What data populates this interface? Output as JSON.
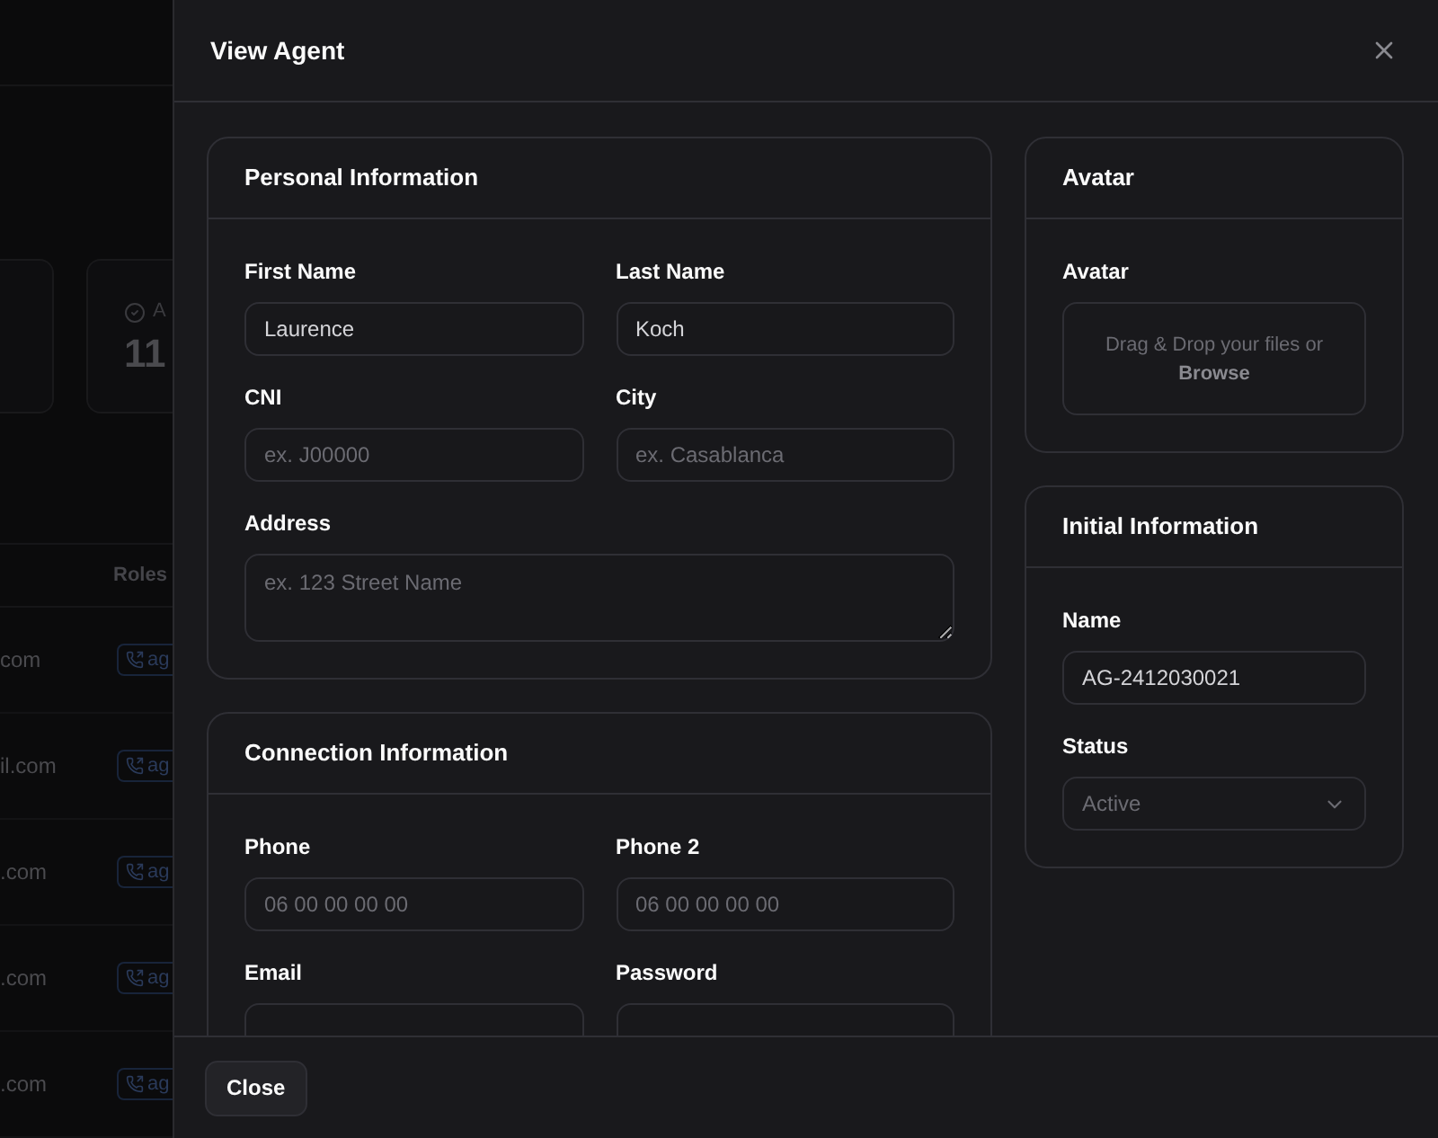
{
  "background": {
    "stat_card": {
      "label": "A",
      "value": "11"
    },
    "table": {
      "columns": [
        "Roles"
      ],
      "rows": [
        {
          "email": "com",
          "role": "ag"
        },
        {
          "email": "il.com",
          "role": "ag"
        },
        {
          "email": ".com",
          "role": "ag"
        },
        {
          "email": ".com",
          "role": "ag"
        },
        {
          "email": ".com",
          "role": "ag"
        }
      ]
    }
  },
  "drawer": {
    "title": "View Agent",
    "left_sections": [
      {
        "title": "Personal Information",
        "fields": [
          {
            "kind": "input",
            "label": "First Name",
            "value": "Laurence"
          },
          {
            "kind": "input",
            "label": "Last Name",
            "value": "Koch"
          },
          {
            "kind": "input",
            "label": "CNI",
            "placeholder": "ex. J00000"
          },
          {
            "kind": "input",
            "label": "City",
            "placeholder": "ex. Casablanca"
          },
          {
            "kind": "textarea",
            "label": "Address",
            "placeholder": "ex. 123 Street Name"
          }
        ]
      },
      {
        "title": "Connection Information",
        "fields": [
          {
            "kind": "input",
            "label": "Phone",
            "placeholder": "06 00 00 00 00"
          },
          {
            "kind": "input",
            "label": "Phone 2",
            "placeholder": "06 00 00 00 00"
          },
          {
            "kind": "input",
            "label": "Email"
          },
          {
            "kind": "input",
            "label": "Password"
          }
        ]
      }
    ],
    "right_sections": [
      {
        "title": "Avatar",
        "fields": [
          {
            "kind": "dropzone",
            "label": "Avatar",
            "text": "Drag & Drop your files or\n**Browse**"
          }
        ]
      },
      {
        "title": "Initial Information",
        "fields": [
          {
            "kind": "input",
            "label": "Name",
            "value": "AG-2412030021"
          },
          {
            "kind": "select",
            "label": "Status",
            "value": "Active",
            "disabled": true
          }
        ]
      }
    ],
    "footer_button": "Close"
  }
}
